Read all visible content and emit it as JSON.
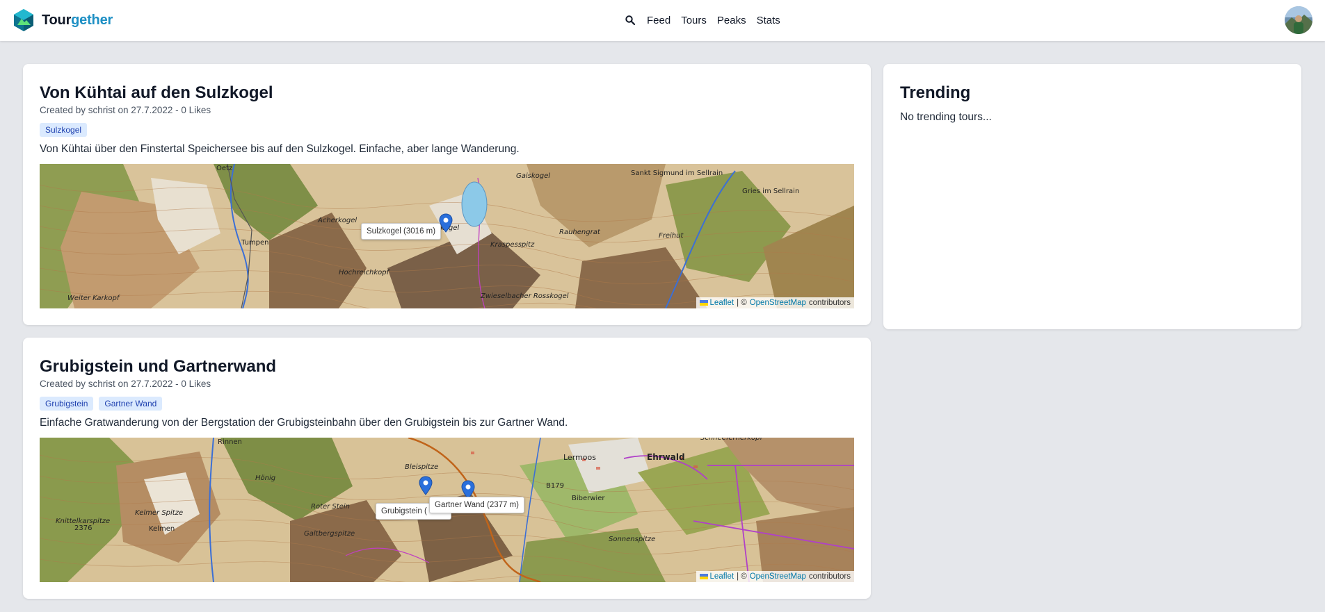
{
  "app": {
    "brand_part1": "Tour",
    "brand_part2": "gether",
    "accent_color": "#1d8fc4"
  },
  "nav": {
    "search_icon": "search-icon",
    "links": [
      "Feed",
      "Tours",
      "Peaks",
      "Stats"
    ]
  },
  "tours": [
    {
      "title": "Von Kühtai auf den Sulzkogel",
      "meta": "Created by schrist on 27.7.2022 - 0 Likes",
      "tags": [
        "Sulzkogel"
      ],
      "description": "Von Kühtai über den Finstertal Speichersee bis auf den Sulzkogel. Einfache, aber lange Wanderung.",
      "map": {
        "tooltips": [
          "Sulzkogel (3016 m)"
        ],
        "places": [
          "Oetz",
          "Gaiskogel",
          "Sankt Sigmund im Sellrain",
          "Gries im Sellrain",
          "Acherkogel",
          "Rauhengrat",
          "Kraspesspitz",
          "Freihut",
          "Tumpen",
          "Hochreichkopf",
          "Weiter Karkopf",
          "Zwieselbacher Rosskogel",
          "kogel"
        ]
      }
    },
    {
      "title": "Grubigstein und Gartnerwand",
      "meta": "Created by schrist on 27.7.2022 - 0 Likes",
      "tags": [
        "Grubigstein",
        "Gartner Wand"
      ],
      "description": "Einfache Gratwanderung von der Bergstation der Grubigsteinbahn über den Grubigstein bis zur Gartner Wand.",
      "map": {
        "tooltips": [
          "Grubigstein (",
          "Gartner Wand (2377 m)"
        ],
        "places": [
          "Rinnen",
          "Bleispitze",
          "Lermoos",
          "Ehrwald",
          "Schneefernerkopf",
          "Hönig",
          "Biberwier",
          "B179",
          "Roter Stein",
          "Kelmer Spitze",
          "Knittelkarspitze",
          "2376",
          "Kelmen",
          "Galtbergspitze",
          "Sonnenspitze",
          "gstein"
        ]
      }
    }
  ],
  "attribution": {
    "leaflet": "Leaflet",
    "separator": "| ©",
    "osm": "OpenStreetMap",
    "suffix": "contributors"
  },
  "trending": {
    "title": "Trending",
    "empty_text": "No trending tours..."
  }
}
